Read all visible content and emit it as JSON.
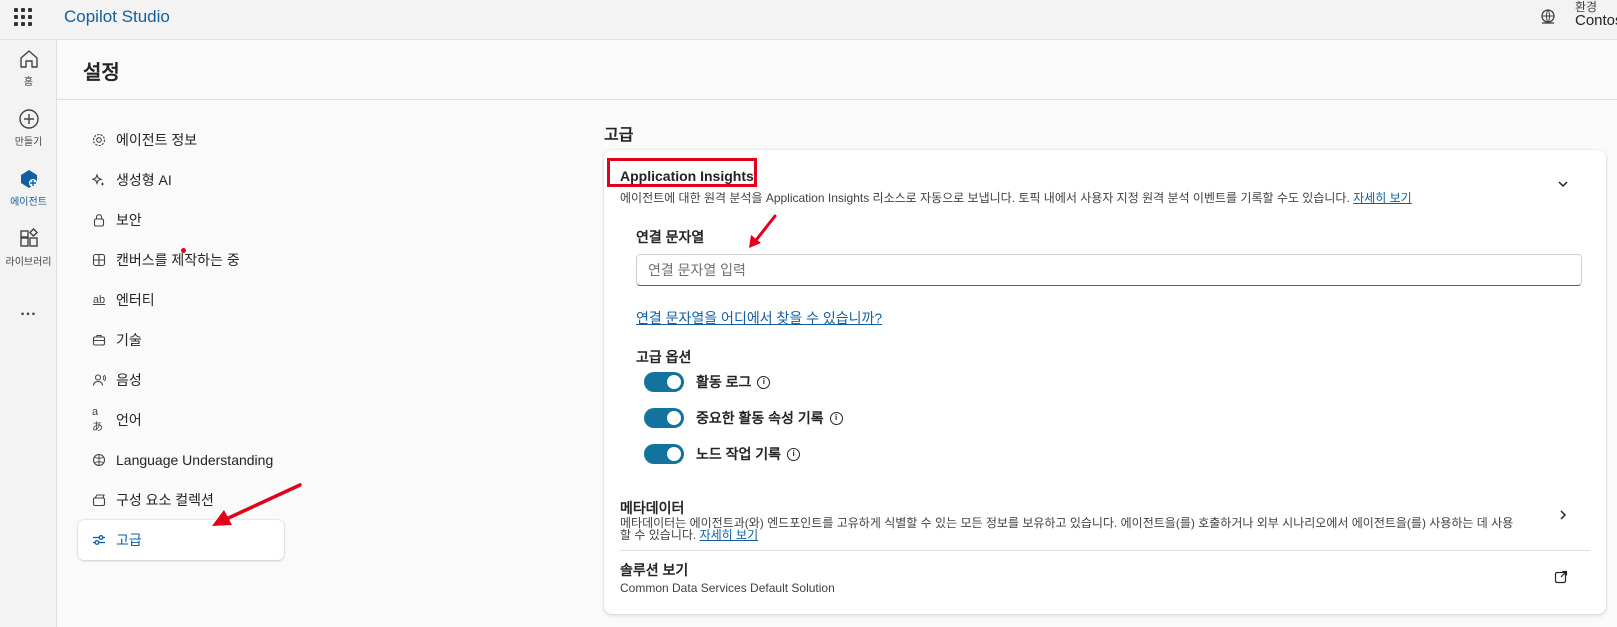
{
  "app": {
    "title": "Copilot Studio"
  },
  "environment": {
    "label": "환경",
    "value": "Contos"
  },
  "rail": [
    {
      "label": "홈",
      "icon": "home-icon"
    },
    {
      "label": "만들기",
      "icon": "plus-circle-icon"
    },
    {
      "label": "에이전트",
      "icon": "agent-icon",
      "active": true
    },
    {
      "label": "라이브러리",
      "icon": "library-icon"
    },
    {
      "label": "...",
      "icon": "more-icon"
    }
  ],
  "page": {
    "title": "설정"
  },
  "nav": [
    {
      "label": "에이전트 정보",
      "icon": "gear-icon"
    },
    {
      "label": "생성형 AI",
      "icon": "sparkle-icon"
    },
    {
      "label": "보안",
      "icon": "lock-icon"
    },
    {
      "label": "캔버스를 제작하는 중",
      "icon": "grid-icon"
    },
    {
      "label": "엔터티",
      "icon": "entity-icon"
    },
    {
      "label": "기술",
      "icon": "briefcase-icon"
    },
    {
      "label": "음성",
      "icon": "voice-icon"
    },
    {
      "label": "언어",
      "icon": "language-icon"
    },
    {
      "label": "Language Understanding",
      "icon": "brain-icon"
    },
    {
      "label": "구성 요소 컬렉션",
      "icon": "collection-icon"
    },
    {
      "label": "고급",
      "icon": "sliders-icon",
      "selected": true
    }
  ],
  "section": {
    "title": "고급"
  },
  "app_insights": {
    "title": "Application Insights",
    "description": "에이전트에 대한 원격 분석을 Application Insights 리소스로 자동으로 보냅니다. 토픽 내에서 사용자 지정 원격 분석 이벤트를 기록할 수도 있습니다.",
    "learn_more": "자세히 보기",
    "connection_label": "연결 문자열",
    "connection_placeholder": "연결 문자열 입력",
    "connection_value": "",
    "help_link": "연결 문자열을 어디에서 찾을 수 있습니까?",
    "advanced_label": "고급 옵션",
    "toggles": [
      {
        "label": "활동 로그",
        "on": true
      },
      {
        "label": "중요한 활동 속성 기록",
        "on": true
      },
      {
        "label": "노드 작업 기록",
        "on": true
      }
    ]
  },
  "metadata": {
    "title": "메타데이터",
    "description": "메타데이터는 에이전트과(와) 엔드포인트를 고유하게 식별할 수 있는 모든 정보를 보유하고 있습니다. 에이전트을(를) 호출하거나 외부 시나리오에서 에이전트을(를) 사용하는 데 사용할 수 있습니다.",
    "learn_more": "자세히 보기"
  },
  "solution": {
    "title": "솔루션 보기",
    "value": "Common Data Services Default Solution"
  },
  "colors": {
    "accent": "#115ea3",
    "toggle": "#11739e",
    "annotation": "#e3001b"
  }
}
